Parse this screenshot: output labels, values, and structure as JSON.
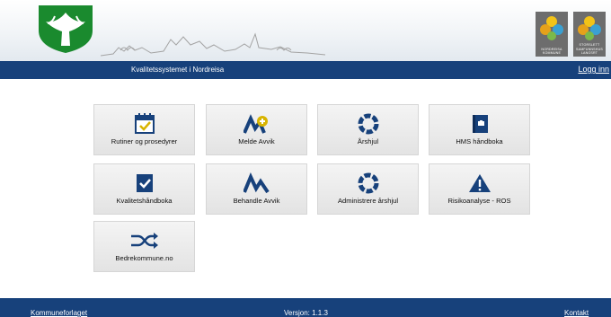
{
  "header": {
    "logo1_text": "NORDREISA KOMMUNE",
    "logo2_text": "STORSLETT SAMFUNNSHUS LANGSRT"
  },
  "topbar": {
    "title": "Kvalitetssystemet i Nordreisa",
    "login_label": "Logg inn"
  },
  "tiles": [
    {
      "label": "Rutiner og prosedyrer",
      "icon": "calendar-check-icon"
    },
    {
      "label": "Melde Avvik",
      "icon": "chart-plus-icon"
    },
    {
      "label": "Årshjul",
      "icon": "year-wheel-icon"
    },
    {
      "label": "HMS håndboka",
      "icon": "handbook-icon"
    },
    {
      "label": "Kvalitetshåndboka",
      "icon": "book-check-icon"
    },
    {
      "label": "Behandle Avvik",
      "icon": "wave-chart-icon"
    },
    {
      "label": "Administrere årshjul",
      "icon": "year-wheel-icon"
    },
    {
      "label": "Risikoanalyse - ROS",
      "icon": "warning-icon"
    },
    {
      "label": "Bedrekommune.no",
      "icon": "shuffle-icon"
    }
  ],
  "footer": {
    "left_link": "Kommuneforlaget",
    "version": "Versjon: 1.1.3",
    "right_link": "Kontakt"
  },
  "colors": {
    "navy": "#17417b",
    "crest_green": "#1a8a2e",
    "icon_blue": "#17417b",
    "tile_bg": "#ececec"
  }
}
